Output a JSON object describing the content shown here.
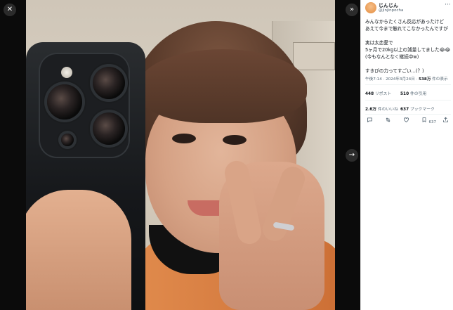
{
  "viewer": {
    "close_glyph": "✕",
    "collapse_glyph": "»",
    "next_glyph": "→"
  },
  "post": {
    "display_name": "じんじん",
    "handle": "@jinjinpocha",
    "more_glyph": "···",
    "lines": [
      "みんなからたくさん反応があったけど",
      "あえて今まで触れてこなかったんですが",
      "",
      "実は太恋愛で",
      "5ヶ月で20kg以上の減量してました😂😂",
      "(今もなんとなく継続中w)",
      "",
      "すきぴの力ってすごい...(？)"
    ],
    "time": "午後7:14",
    "date": "2024年3月24日",
    "views_value": "538万",
    "views_label": "件の表示",
    "reposts_value": "448",
    "reposts_label": "リポスト",
    "quotes_value": "510",
    "quotes_label": "件の引用",
    "likes_value": "2.6万",
    "likes_label": "件のいいね",
    "bookmarks_value": "637",
    "bookmarks_label": "ブックマーク",
    "bookmark_count_small": "637"
  },
  "icons": {
    "reply": "reply-icon",
    "repost": "repost-icon",
    "like": "heart-icon",
    "bookmark": "bookmark-icon",
    "share": "share-icon"
  },
  "colors": {
    "text_primary": "#0f1419",
    "text_secondary": "#536471",
    "shirt": "#e08a4c"
  }
}
